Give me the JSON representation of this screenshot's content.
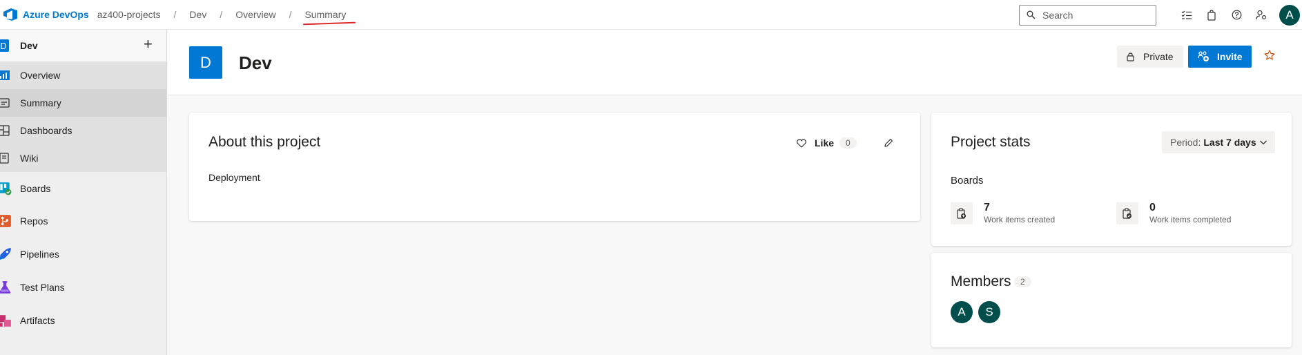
{
  "brand": {
    "name": "Azure DevOps"
  },
  "breadcrumb": [
    "az400-projects",
    "Dev",
    "Overview",
    "Summary"
  ],
  "search": {
    "placeholder": "Search"
  },
  "user": {
    "initial": "A"
  },
  "sidebar": {
    "project_initial": "D",
    "project_name": "Dev",
    "items": [
      {
        "label": "Overview",
        "icon": "overview-icon"
      },
      {
        "label": "Summary",
        "icon": "summary-icon",
        "selected": true
      },
      {
        "label": "Dashboards",
        "icon": "dashboards-icon"
      },
      {
        "label": "Wiki",
        "icon": "wiki-icon"
      },
      {
        "label": "Boards",
        "icon": "boards-icon"
      },
      {
        "label": "Repos",
        "icon": "repos-icon"
      },
      {
        "label": "Pipelines",
        "icon": "pipelines-icon"
      },
      {
        "label": "Test Plans",
        "icon": "test-plans-icon"
      },
      {
        "label": "Artifacts",
        "icon": "artifacts-icon"
      }
    ]
  },
  "header": {
    "project_initial": "D",
    "project_title": "Dev",
    "private_label": "Private",
    "invite_label": "Invite"
  },
  "about": {
    "title": "About this project",
    "like_label": "Like",
    "like_count": "0",
    "description": "Deployment"
  },
  "stats": {
    "title": "Project stats",
    "period_label": "Period:",
    "period_value": "Last 7 days",
    "section": "Boards",
    "created_value": "7",
    "created_caption": "Work items created",
    "completed_value": "0",
    "completed_caption": "Work items completed"
  },
  "members": {
    "title": "Members",
    "count": "2",
    "avatars": [
      "A",
      "S"
    ]
  },
  "colors": {
    "accent": "#0078d4",
    "avatar": "#004e4c",
    "underline": "#e0292b"
  }
}
